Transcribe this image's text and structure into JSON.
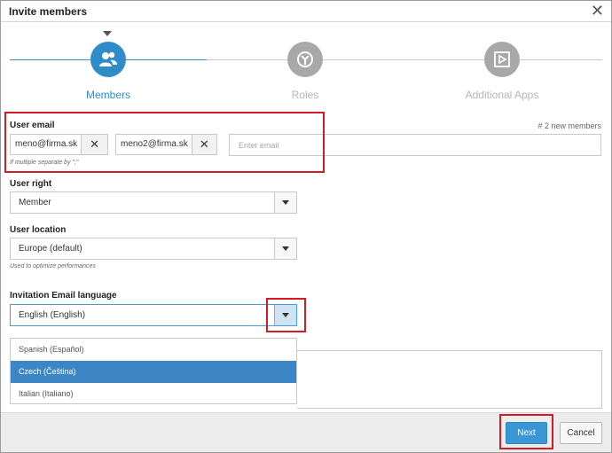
{
  "dialog": {
    "title": "Invite members",
    "close_icon": "close-icon"
  },
  "stepper": {
    "steps": [
      {
        "label": "Members",
        "icon": "users-icon",
        "active": true
      },
      {
        "label": "Roles",
        "icon": "roles-icon",
        "active": false
      },
      {
        "label": "Additional Apps",
        "icon": "play-icon",
        "active": false
      }
    ]
  },
  "user_email": {
    "label": "User email",
    "chips": [
      "meno@firma.sk",
      "meno2@firma.sk"
    ],
    "placeholder": "Enter email",
    "hint": "If multiple separate by \";\"",
    "new_count": "# 2 new members"
  },
  "user_right": {
    "label": "User right",
    "value": "Member"
  },
  "user_location": {
    "label": "User location",
    "value": "Europe (default)",
    "hint": "Used to optimize performances"
  },
  "email_language": {
    "label": "Invitation Email language",
    "value": "English (English)",
    "options": [
      "Spanish (Español)",
      "Czech (Čeština)",
      "Italian (Italiano)"
    ],
    "selected_option": "Czech (Čeština)"
  },
  "footer": {
    "next_label": "Next",
    "cancel_label": "Cancel"
  },
  "colors": {
    "accent": "#2f8cc9",
    "highlight": "#d21b24"
  }
}
